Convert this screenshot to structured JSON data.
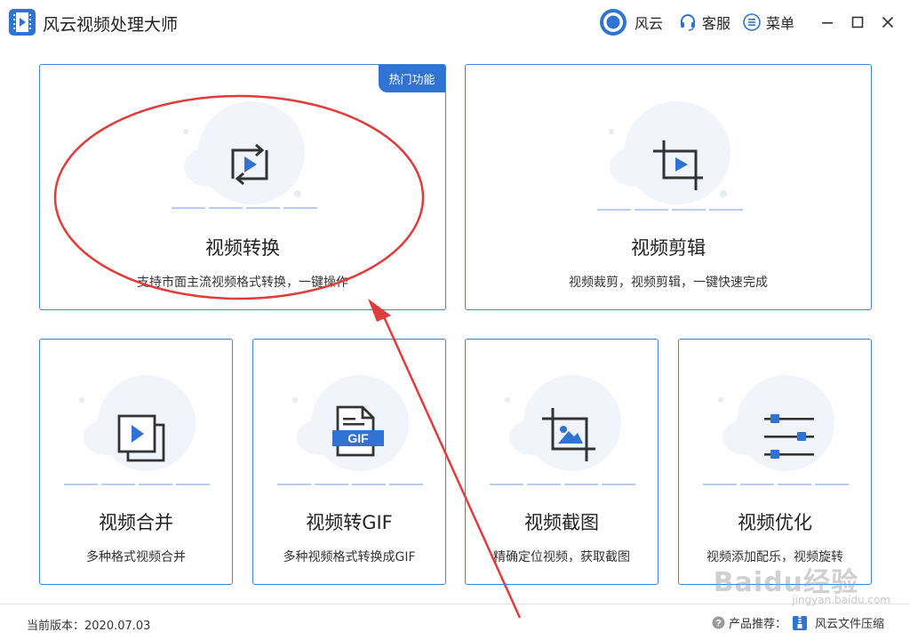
{
  "app": {
    "title": "风云视频处理大师",
    "accent_color": "#2f74d3",
    "logo_icon": "film-play-icon"
  },
  "titlebar": {
    "brand_label": "风云",
    "brand_icon": "circle-logo-icon",
    "service_label": "客服",
    "service_icon": "headset-icon",
    "menu_label": "菜单",
    "menu_icon": "list-menu-icon",
    "window_controls": [
      "minimize-icon",
      "maximize-icon",
      "close-icon"
    ]
  },
  "cards": {
    "convert": {
      "title": "视频转换",
      "desc": "支持市面主流视频格式转换，一键操作",
      "badge": "热门功能",
      "icon": "convert-play-icon"
    },
    "edit": {
      "title": "视频剪辑",
      "desc": "视频裁剪，视频剪辑，一键快速完成",
      "icon": "crop-play-icon"
    },
    "merge": {
      "title": "视频合并",
      "desc": "多种格式视频合并",
      "icon": "stacked-play-icon"
    },
    "gif": {
      "title": "视频转GIF",
      "desc": "多种视频格式转换成GIF",
      "icon": "gif-file-icon",
      "icon_text": "GIF"
    },
    "screenshot": {
      "title": "视频截图",
      "desc": "精确定位视频，获取截图",
      "icon": "crop-image-icon"
    },
    "optimize": {
      "title": "视频优化",
      "desc": "视频添加配乐，视频旋转",
      "icon": "sliders-icon"
    }
  },
  "footer": {
    "version_label": "当前版本：",
    "version_value": "2020.07.03",
    "recommend_label": "产品推荐：",
    "recommend_product": "风云文件压缩",
    "help_icon": "question-circle-icon",
    "product_icon": "zip-file-icon"
  },
  "watermark": {
    "text": "Baidu经验",
    "sub": "jingyan.baidu.com"
  }
}
